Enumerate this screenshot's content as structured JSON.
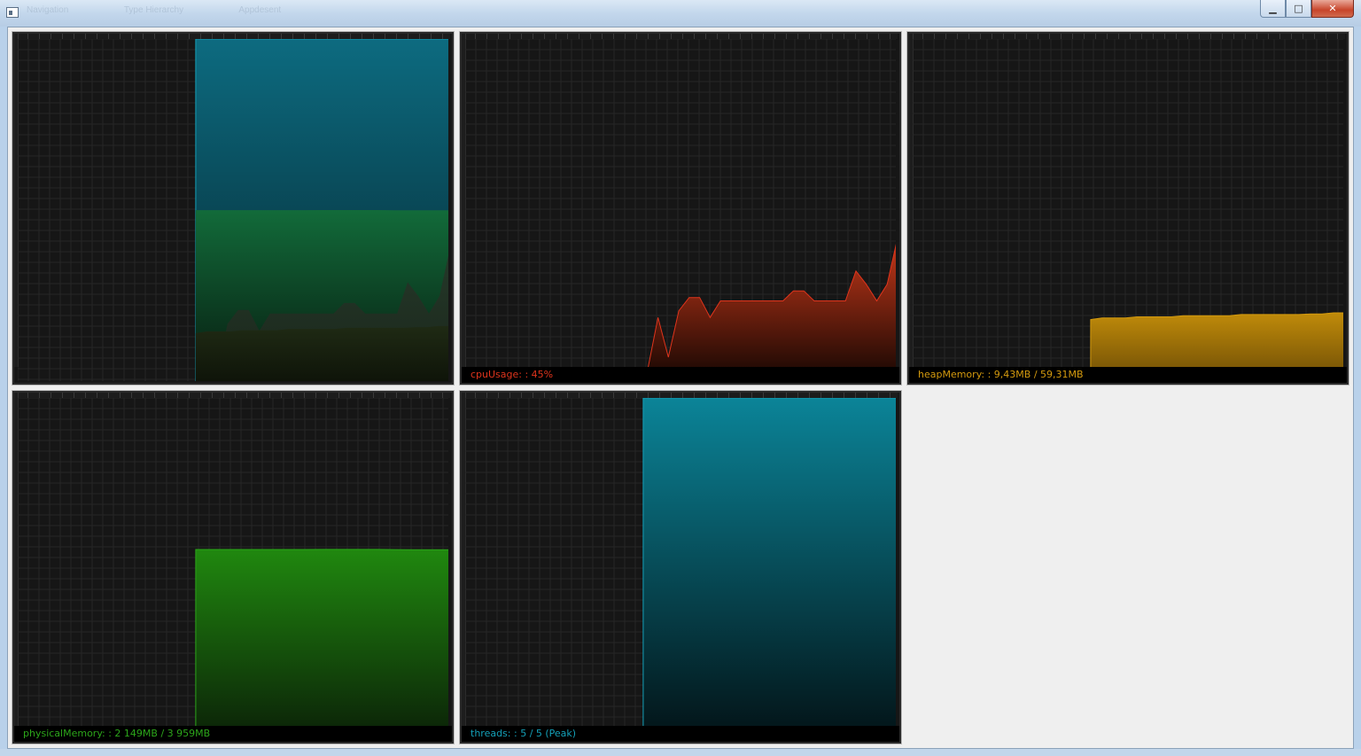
{
  "window": {
    "faded_title_items": [
      "Navigation",
      "Type Hierarchy",
      "Appdesent"
    ],
    "minimize_glyph": "▁",
    "maximize_glyph": "□",
    "close_glyph": "✕"
  },
  "colors": {
    "cpu": "#e0341c",
    "heap": "#d49a0e",
    "physical": "#2ca61a",
    "threads": "#14a0b8",
    "panel_bg": "#161616",
    "grid": "#262626"
  },
  "panels": {
    "combined": {
      "label": ""
    },
    "cpu": {
      "label": "cpuUsage: : 45%",
      "series": [
        0,
        16,
        4,
        18,
        22,
        22,
        16,
        21,
        21,
        21,
        21,
        21,
        21,
        21,
        24,
        24,
        21,
        21,
        21,
        21,
        30,
        26,
        21,
        26,
        40
      ],
      "ylim": [
        0,
        100
      ]
    },
    "heap": {
      "label": "heapMemory: : 9,43MB / 59,31MB",
      "series": [
        9.1,
        9.4,
        9.4,
        9.4,
        9.6,
        9.6,
        9.6,
        9.6,
        9.8,
        9.8,
        9.8,
        9.8,
        9.8,
        10.0,
        10.0,
        10.0,
        10.0,
        10.0,
        10.0,
        10.1,
        10.1,
        10.3,
        10.3
      ],
      "ylim": [
        0,
        59.31
      ]
    },
    "physical": {
      "label": "physicalMemory: : 2 149MB / 3 959MB",
      "series": [
        2149,
        2149,
        2149,
        2149,
        2149,
        2149,
        2149,
        2150,
        2150,
        2150,
        2150,
        2148,
        2147,
        2147,
        2147
      ],
      "ylim": [
        0,
        3959
      ]
    },
    "threads": {
      "label": "threads: : 5 / 5 (Peak)",
      "series": [
        5,
        5,
        5,
        5,
        5,
        5,
        5,
        5
      ],
      "ylim": [
        0,
        5
      ]
    }
  }
}
